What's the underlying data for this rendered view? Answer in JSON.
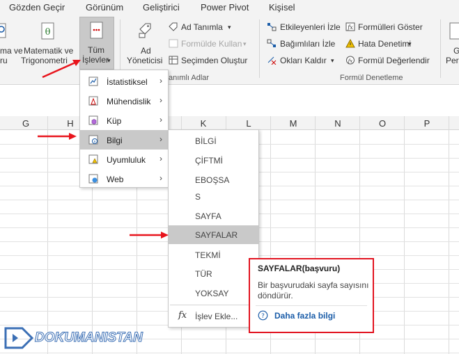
{
  "tabs": [
    "Gözden Geçir",
    "Görünüm",
    "Geliştirici",
    "Power Pivot",
    "Kişisel"
  ],
  "ribbon": {
    "left_cut_1": "ma ve",
    "left_cut_2": "ru",
    "math_1": "Matematik ve",
    "math_2": "Trigonometri",
    "all_1": "Tüm",
    "all_2": "İşlevler",
    "name_manager_1": "Ad",
    "name_manager_2": "Yöneticisi",
    "define_name": "Ad Tanımla",
    "use_in_formula": "Formülde Kullan",
    "create_from_selection": "Seçimden Oluştur",
    "defined_names_group": "anımlı Adlar",
    "trace_precedents": "Etkileyenleri İzle",
    "trace_dependents": "Bağımlıları İzle",
    "remove_arrows": "Okları Kaldır",
    "show_formulas": "Formülleri Göster",
    "error_checking": "Hata Denetimi",
    "evaluate_formula": "Formül Değerlendir",
    "audit_group": "Formül Denetleme",
    "right_cut_1": "G",
    "right_cut_2": "Per"
  },
  "columns": [
    "G",
    "H",
    "K",
    "L",
    "M",
    "N",
    "O",
    "P"
  ],
  "menu1": [
    {
      "label": "İstatistiksel"
    },
    {
      "label": "Mühendislik"
    },
    {
      "label": "Küp"
    },
    {
      "label": "Bilgi"
    },
    {
      "label": "Uyumluluk"
    },
    {
      "label": "Web"
    }
  ],
  "menu2": [
    "BİLGİ",
    "ÇİFTMİ",
    "EBOŞSA",
    "S",
    "SAYFA",
    "SAYFALAR",
    "TEKMİ",
    "TÜR",
    "YOKSAY"
  ],
  "insert_function": {
    "icon": "fx",
    "label": "İşlev Ekle..."
  },
  "tooltip": {
    "title": "SAYFALAR(başvuru)",
    "desc_1": "Bir başvurudaki sayfa sayısını",
    "desc_2": "döndürür.",
    "more": "Daha fazla bilgi"
  },
  "watermark": "DOKUMANISTAN",
  "colors": {
    "accent": "#1a5ca8",
    "highlight": "#c9c9c9",
    "annotation": "#e2131f"
  }
}
